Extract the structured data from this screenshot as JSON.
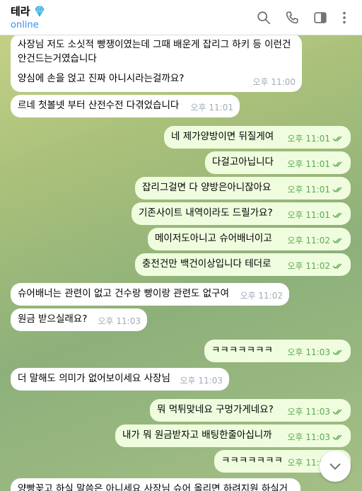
{
  "header": {
    "title": "테라",
    "title_icon": "gem-icon",
    "status": "online",
    "icons": [
      "search-icon",
      "phone-icon",
      "sidebar-toggle-icon",
      "more-vertical-icon"
    ]
  },
  "colors": {
    "accent": "#3390ec",
    "outgoing_bubble": "#effdde",
    "incoming_bubble": "#ffffff",
    "outgoing_meta": "#5ca853"
  },
  "messages": [
    {
      "dir": "in",
      "lines": [
        "사장님 저도 소싯적 빵쟁이였는데 그때 배운게 잡리그 하키 등 이런건",
        "안건드는거였습니다",
        "",
        "양심에 손을 얹고 진짜 아니시라는걸까요?"
      ],
      "time": "오후 11:00"
    },
    {
      "dir": "in",
      "lines": [
        "르네 첫볼넷 부터 산전수전 다겪었습니다"
      ],
      "time": "오후 11:01"
    },
    {
      "dir": "out",
      "lines": [
        "네 제가양방이면 뒤질게여"
      ],
      "time": "오후 11:01"
    },
    {
      "dir": "out",
      "lines": [
        "다걸고아닙니다"
      ],
      "time": "오후 11:01"
    },
    {
      "dir": "out",
      "lines": [
        "잡리그걸면 다 양방은아니잖아요"
      ],
      "time": "오후 11:01"
    },
    {
      "dir": "out",
      "lines": [
        "기존사이트 내역이라도 드릴가요?"
      ],
      "time": "오후 11:01"
    },
    {
      "dir": "out",
      "lines": [
        "메이저도아니고 슈어배너이고"
      ],
      "time": "오후 11:02"
    },
    {
      "dir": "out",
      "lines": [
        "충전건만 백건이상입니다 테더로"
      ],
      "time": "오후 11:02"
    },
    {
      "dir": "in",
      "lines": [
        "슈어배너는 관련이 없고 건수랑 빵이랑 관련도 없구여"
      ],
      "time": "오후 11:02"
    },
    {
      "dir": "in",
      "lines": [
        "원금 받으실래요?"
      ],
      "time": "오후 11:03"
    },
    {
      "dir": "out",
      "lines": [
        "ㅋㅋㅋㅋㅋㅋㅋ"
      ],
      "time": "오후 11:03"
    },
    {
      "dir": "in",
      "lines": [
        "더 말해도 의미가 없어보이세요 사장님"
      ],
      "time": "오후 11:03"
    },
    {
      "dir": "out",
      "lines": [
        "뭐 먹튀맞네요 구멍가게네요?"
      ],
      "time": "오후 11:03"
    },
    {
      "dir": "out",
      "lines": [
        "내가 뭐 원금받자고 배팅한줄아십니까"
      ],
      "time": "오후 11:03"
    },
    {
      "dir": "out",
      "lines": [
        "ㅋㅋㅋㅋㅋㅋㅋ"
      ],
      "time": "오후 11:03"
    },
    {
      "dir": "in",
      "lines": [
        "양빵꽂고 하실 말씀은 아니세요 사장님 슈어 올리면 하려지원 하실거"
      ],
      "time": ""
    }
  ],
  "scroll_down_icon": "chevron-down-icon"
}
